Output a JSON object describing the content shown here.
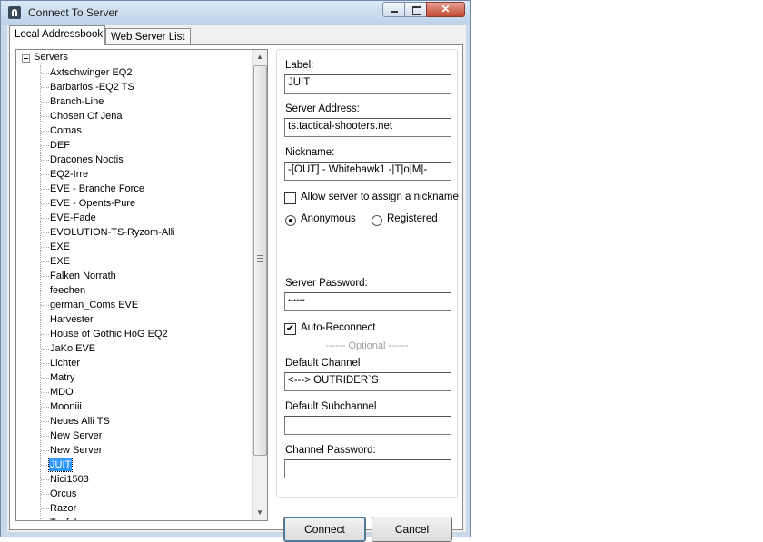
{
  "window": {
    "title": "Connect To Server",
    "close_symbol": "✕"
  },
  "tabs": [
    {
      "label": "Local Addressbook",
      "active": true
    },
    {
      "label": "Web Server List",
      "active": false
    }
  ],
  "tree": {
    "root_label": "Servers",
    "items": [
      "Axtschwinger EQ2",
      "Barbarios -EQ2 TS",
      "Branch-Line",
      "Chosen Of Jena",
      "Comas",
      "DEF",
      "Dracones Noctis",
      "EQ2-Irre",
      "EVE - Branche Force",
      "EVE - Opents-Pure",
      "EVE-Fade",
      "EVOLUTION-TS-Ryzom-Alli",
      "EXE",
      "EXE",
      "Falken Norrath",
      "feechen",
      "german_Coms EVE",
      "Harvester",
      "House of Gothic HoG EQ2",
      "JaKo EVE",
      "Lichter",
      "Matry",
      "MDO",
      "Mooniii",
      "Neues Alli TS",
      "New Server",
      "New Server",
      "JUIT",
      "Nici1503",
      "Orcus",
      "Razor",
      "Taufal"
    ],
    "selected": "JUIT"
  },
  "form": {
    "label_caption": "Label:",
    "label_value": "JUIT",
    "address_caption": "Server Address:",
    "address_value": "ts.tactical-shooters.net",
    "nickname_caption": "Nickname:",
    "nickname_value": "-[OUT] - Whitehawk1 -|T|o|M|-",
    "allow_nick_caption": "Allow server to assign a nickname",
    "allow_nick_checked": false,
    "anonymous_caption": "Anonymous",
    "registered_caption": "Registered",
    "login_mode": "Anonymous",
    "password_caption": "Server Password:",
    "password_value": "******",
    "auto_reconnect_caption": "Auto-Reconnect",
    "auto_reconnect_checked": true,
    "auto_reconnect_mark": "✔",
    "optional_hint": "------ Optional ------",
    "default_channel_caption": "Default Channel",
    "default_channel_value": "<---> OUTRIDER`S",
    "default_subchannel_caption": "Default Subchannel",
    "default_subchannel_value": "",
    "channel_password_caption": "Channel Password:",
    "channel_password_value": ""
  },
  "buttons": {
    "connect": "Connect",
    "cancel": "Cancel"
  }
}
